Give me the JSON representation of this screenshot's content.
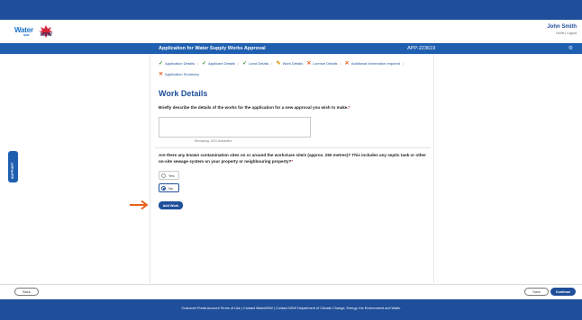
{
  "header": {
    "logo_water": "Water",
    "logo_water_sub": "NSW",
    "logo_nsw": "NSW",
    "user_name": "John Smith",
    "user_links": "Home | Logout"
  },
  "title_bar": {
    "title": "Application for Water Supply Works Approval",
    "app_id": "APP-223619"
  },
  "steps": [
    {
      "label": "Application Details",
      "status": "done"
    },
    {
      "label": "Applicant Details",
      "status": "done"
    },
    {
      "label": "Land Details",
      "status": "done"
    },
    {
      "label": "Work Details",
      "status": "current"
    },
    {
      "label": "Licence Details",
      "status": "todo"
    },
    {
      "label": "Additional information required",
      "status": "todo"
    },
    {
      "label": "Application Summary",
      "status": "todo"
    }
  ],
  "form": {
    "section_title": "Work Details",
    "question1": "Briefly describe the details of the works for the application for a new approval you wish to make.",
    "required_mark": "*",
    "textarea_value": "",
    "remaining": "Remaining: 1024 characters",
    "question2": "Are there any known contamination sites on or around the works/use site/s (approx. 250 metres)? This includes any septic tank or other on-site sewage system on your property or neighbouring property?",
    "radio_yes": "Yes",
    "radio_no": "No",
    "selected": "No",
    "add_work": "Add Work"
  },
  "support_tab": "SUPPORT",
  "nav": {
    "back": "Back",
    "save": "Save",
    "continue": "Continue"
  },
  "footer": {
    "text": "Customer Portal   Account   Terms of Use  |  Contact WaterNSW  |  Contact NSW Department of Climate Change, Energy, the Environment and Water"
  },
  "colors": {
    "brand": "#1f4f9a",
    "accent_arrow": "#e8621c",
    "done": "#2f8f2f",
    "current": "#e0a020",
    "todo": "#e05a1c"
  }
}
